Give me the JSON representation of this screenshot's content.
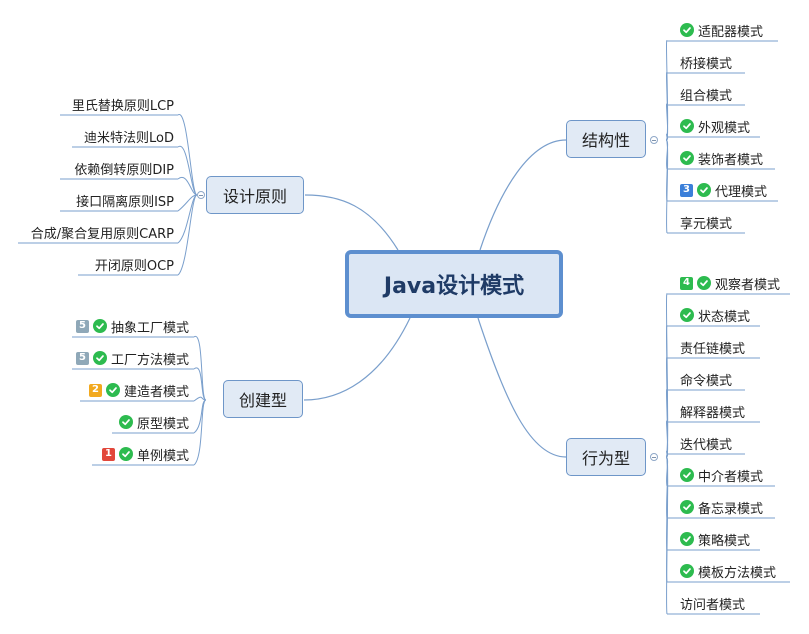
{
  "root": {
    "title": "Java设计模式"
  },
  "branches": {
    "principles": {
      "title": "设计原则",
      "items": [
        {
          "label": "里氏替换原则LCP"
        },
        {
          "label": "迪米特法则LoD"
        },
        {
          "label": "依赖倒转原则DIP"
        },
        {
          "label": "接口隔离原则ISP"
        },
        {
          "label": "合成/聚合复用原则CARP"
        },
        {
          "label": "开闭原则OCP"
        }
      ]
    },
    "creational": {
      "title": "创建型",
      "items": [
        {
          "label": "抽象工厂模式",
          "badge": "5",
          "badge_color": "#8fa8b8",
          "check": true
        },
        {
          "label": "工厂方法模式",
          "badge": "5",
          "badge_color": "#8fa8b8",
          "check": true
        },
        {
          "label": "建造者模式",
          "badge": "2",
          "badge_color": "#f2a91f",
          "check": true
        },
        {
          "label": "原型模式",
          "check": true
        },
        {
          "label": "单例模式",
          "badge": "1",
          "badge_color": "#e2473b",
          "check": true
        }
      ]
    },
    "structural": {
      "title": "结构性",
      "items": [
        {
          "label": "适配器模式",
          "check": true
        },
        {
          "label": "桥接模式"
        },
        {
          "label": "组合模式"
        },
        {
          "label": "外观模式",
          "check": true
        },
        {
          "label": "装饰者模式",
          "check": true
        },
        {
          "label": "代理模式",
          "badge": "3",
          "badge_color": "#3b7fd9",
          "check": true
        },
        {
          "label": "享元模式"
        }
      ]
    },
    "behavioral": {
      "title": "行为型",
      "items": [
        {
          "label": "观察者模式",
          "badge": "4",
          "badge_color": "#2dbb4f",
          "check": true
        },
        {
          "label": "状态模式",
          "check": true
        },
        {
          "label": "责任链模式"
        },
        {
          "label": "命令模式"
        },
        {
          "label": "解释器模式"
        },
        {
          "label": "迭代模式"
        },
        {
          "label": "中介者模式",
          "check": true
        },
        {
          "label": "备忘录模式",
          "check": true
        },
        {
          "label": "策略模式",
          "check": true
        },
        {
          "label": "模板方法模式",
          "check": true
        },
        {
          "label": "访问者模式"
        }
      ]
    }
  },
  "colors": {
    "line": "#7a9fcc",
    "check": "#2dbb4f"
  },
  "icons": {
    "check": "check-circle-icon",
    "collapse": "collapse-toggle-icon"
  }
}
